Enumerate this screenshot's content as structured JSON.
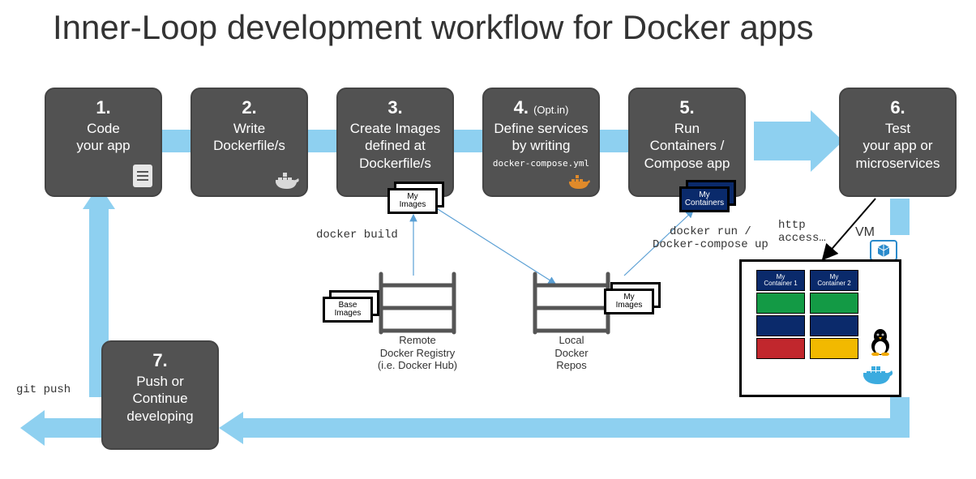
{
  "title": "Inner-Loop development workflow for Docker apps",
  "steps": {
    "s1": {
      "num": "1.",
      "label": "Code\nyour app"
    },
    "s2": {
      "num": "2.",
      "label": "Write\nDockerfile/s"
    },
    "s3": {
      "num": "3.",
      "label": "Create Images\ndefined at\nDockerfile/s"
    },
    "s4": {
      "num": "4.",
      "sub": "(Opt.in)",
      "label": "Define services\nby writing",
      "code": "docker-compose.yml"
    },
    "s5": {
      "num": "5.",
      "label": "Run\nContainers /\nCompose app"
    },
    "s6": {
      "num": "6.",
      "label": "Test\nyour app or\nmicroservices"
    },
    "s7": {
      "num": "7.",
      "label": "Push or\nContinue\ndeveloping"
    }
  },
  "annotations": {
    "docker_build": "docker build",
    "docker_run": "docker run /\nDocker-compose up",
    "http_access": "http\naccess…",
    "git_push": "git push",
    "vm": "VM"
  },
  "shelves": {
    "remote": {
      "label": "Remote\nDocker Registry\n(i.e. Docker Hub)"
    },
    "local": {
      "label": "Local\nDocker\nRepos"
    }
  },
  "image_stacks": {
    "my_images_top": "My\nImages",
    "base_images": "Base\nImages",
    "my_images_local": "My\nImages",
    "my_containers": "My\nContainers"
  },
  "vm_containers": {
    "c1": "My\nContainer 1",
    "c2": "My\nContainer 2"
  },
  "colors": {
    "step_bg": "#525252",
    "arrow": "#8ed0f0",
    "thin_arrow": "#5a9fd4",
    "docker_blue": "#3babdf",
    "container_navy": "#0a2a6b"
  }
}
